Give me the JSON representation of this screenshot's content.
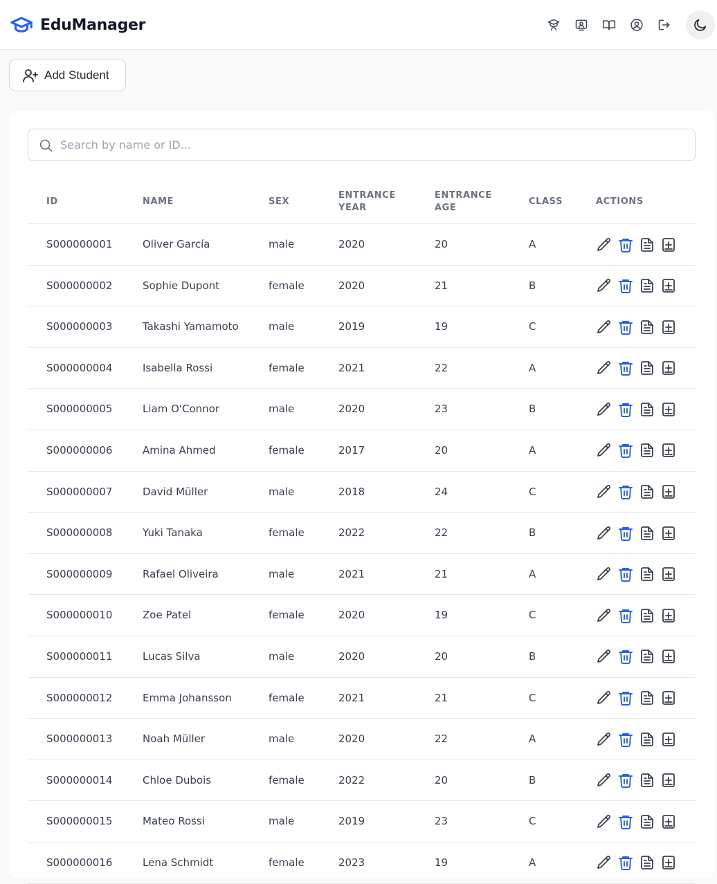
{
  "app": {
    "name": "EduManager",
    "nav_icons": [
      "graduation-teacher-icon",
      "presentation-icon",
      "book-open-icon",
      "user-circle-icon",
      "logout-icon",
      "moon-icon"
    ]
  },
  "toolbar": {
    "add_label": "Add Student"
  },
  "search": {
    "placeholder": "Search by name or ID..."
  },
  "table": {
    "headers": {
      "id": "ID",
      "name": "NAME",
      "sex": "SEX",
      "entrance_year_1": "ENTRANCE",
      "entrance_year_2": "YEAR",
      "entrance_age_1": "ENTRANCE",
      "entrance_age_2": "AGE",
      "class": "CLASS",
      "actions": "ACTIONS"
    },
    "rows": [
      {
        "id": "S000000001",
        "name": "Oliver García",
        "sex": "male",
        "year": "2020",
        "age": "20",
        "class": "A"
      },
      {
        "id": "S000000002",
        "name": "Sophie Dupont",
        "sex": "female",
        "year": "2020",
        "age": "21",
        "class": "B"
      },
      {
        "id": "S000000003",
        "name": "Takashi Yamamoto",
        "sex": "male",
        "year": "2019",
        "age": "19",
        "class": "C"
      },
      {
        "id": "S000000004",
        "name": "Isabella Rossi",
        "sex": "female",
        "year": "2021",
        "age": "22",
        "class": "A"
      },
      {
        "id": "S000000005",
        "name": "Liam O'Connor",
        "sex": "male",
        "year": "2020",
        "age": "23",
        "class": "B"
      },
      {
        "id": "S000000006",
        "name": "Amina Ahmed",
        "sex": "female",
        "year": "2017",
        "age": "20",
        "class": "A"
      },
      {
        "id": "S000000007",
        "name": "David Müller",
        "sex": "male",
        "year": "2018",
        "age": "24",
        "class": "C"
      },
      {
        "id": "S000000008",
        "name": "Yuki Tanaka",
        "sex": "female",
        "year": "2022",
        "age": "22",
        "class": "B"
      },
      {
        "id": "S000000009",
        "name": "Rafael Oliveira",
        "sex": "male",
        "year": "2021",
        "age": "21",
        "class": "A"
      },
      {
        "id": "S000000010",
        "name": "Zoe Patel",
        "sex": "female",
        "year": "2020",
        "age": "19",
        "class": "C"
      },
      {
        "id": "S000000011",
        "name": "Lucas Silva",
        "sex": "male",
        "year": "2020",
        "age": "20",
        "class": "B"
      },
      {
        "id": "S000000012",
        "name": "Emma Johansson",
        "sex": "female",
        "year": "2021",
        "age": "21",
        "class": "C"
      },
      {
        "id": "S000000013",
        "name": "Noah Müller",
        "sex": "male",
        "year": "2020",
        "age": "22",
        "class": "A"
      },
      {
        "id": "S000000014",
        "name": "Chloe Dubois",
        "sex": "female",
        "year": "2022",
        "age": "20",
        "class": "B"
      },
      {
        "id": "S000000015",
        "name": "Mateo Rossi",
        "sex": "male",
        "year": "2019",
        "age": "23",
        "class": "C"
      },
      {
        "id": "S000000016",
        "name": "Lena Schmidt",
        "sex": "female",
        "year": "2023",
        "age": "19",
        "class": "A"
      }
    ],
    "row_actions": [
      "edit-icon",
      "delete-icon",
      "document-icon",
      "add-record-icon"
    ]
  },
  "colors": {
    "accent": "#2563eb",
    "text": "#374151",
    "header_text": "#6b7280",
    "border": "#e5e7eb"
  }
}
